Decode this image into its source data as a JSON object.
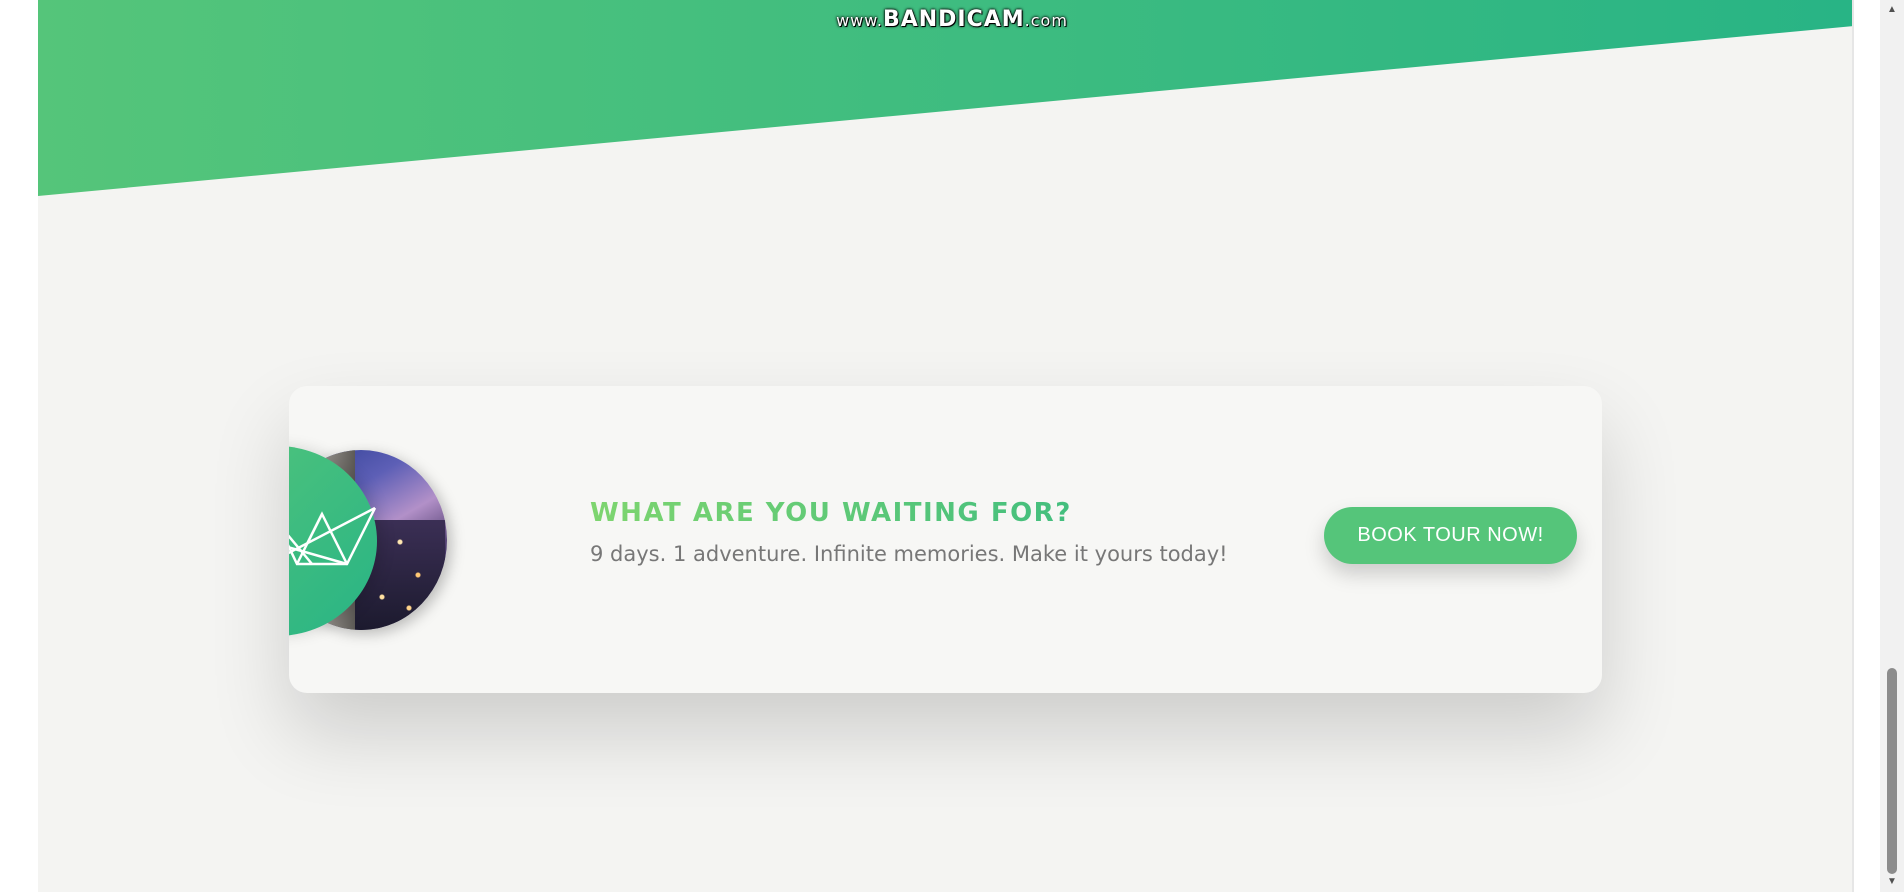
{
  "watermark": {
    "prefix": "www.",
    "brand": "BANDICAM",
    "suffix": ".com"
  },
  "cta": {
    "title": "WHAT ARE YOU WAITING FOR?",
    "subtitle": "9 days. 1 adventure. Infinite memories. Make it yours today!",
    "button_label": "BOOK TOUR NOW!"
  },
  "icons": {
    "logo": "crown-logo-icon",
    "photo": "city-photo",
    "scroll_up": "chevron-up-icon",
    "scroll_down": "chevron-down-icon"
  },
  "colors": {
    "primary": "#55c57a",
    "primary_dark": "#28b485",
    "primary_light": "#7ed56f",
    "text_muted": "#777777",
    "background": "#f4f4f2"
  }
}
